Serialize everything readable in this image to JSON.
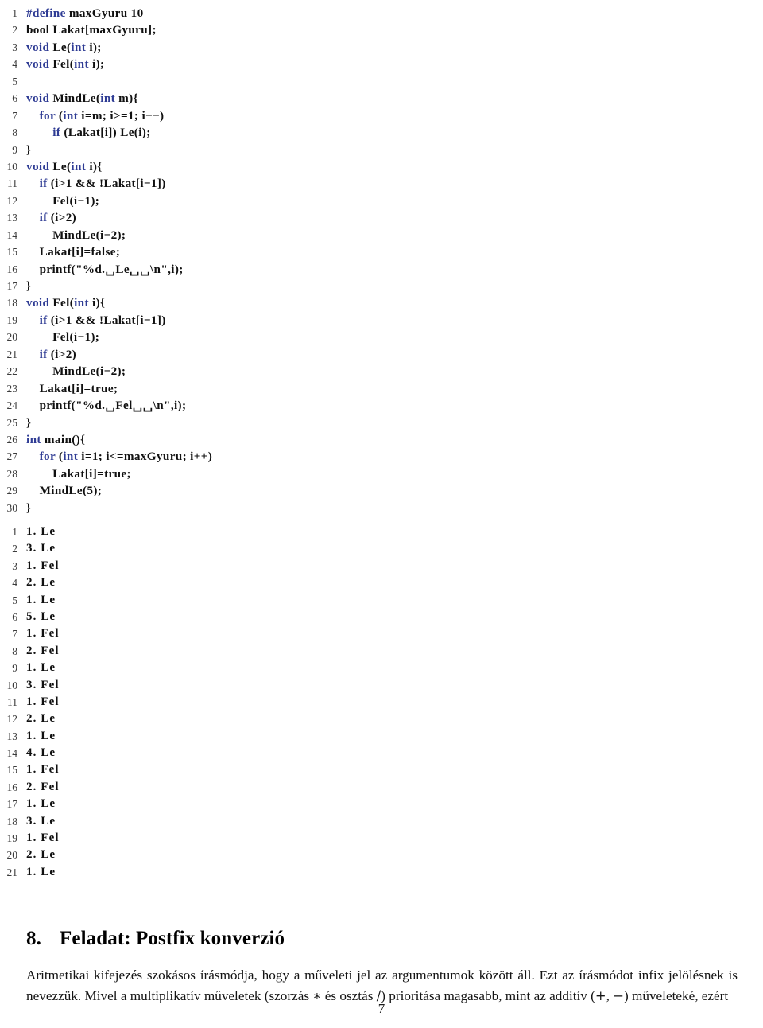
{
  "document": {
    "page_number": "7",
    "language": "hu",
    "keyword_color": "#2e3b94",
    "text_color": "#101010",
    "lineno_color": "#3c3c3c",
    "background_color": "#ffffff"
  },
  "code_listing": {
    "name": "c-source-listing",
    "language": "C",
    "first_line_number": 1,
    "lines": [
      {
        "no": "1",
        "html": "<span class=\"kw\">#define</span> maxGyuru 10"
      },
      {
        "no": "2",
        "html": "bool Lakat[maxGyuru];"
      },
      {
        "no": "3",
        "html": "<span class=\"kw\">void</span> Le(<span class=\"kw\">int</span> i);"
      },
      {
        "no": "4",
        "html": "<span class=\"kw\">void</span> Fel(<span class=\"kw\">int</span> i);"
      },
      {
        "no": "5",
        "html": ""
      },
      {
        "no": "6",
        "html": "<span class=\"kw\">void</span> MindLe(<span class=\"kw\">int</span> m){"
      },
      {
        "no": "7",
        "html": "    <span class=\"kw\">for</span> (<span class=\"kw\">int</span> i=m; i&gt;=1; i−−)"
      },
      {
        "no": "8",
        "html": "        <span class=\"kw\">if</span> (Lakat[i]) Le(i);"
      },
      {
        "no": "9",
        "html": "}"
      },
      {
        "no": "10",
        "html": "<span class=\"kw\">void</span> Le(<span class=\"kw\">int</span> i){"
      },
      {
        "no": "11",
        "html": "    <span class=\"kw\">if</span> (i&gt;1 &amp;&amp; !Lakat[i−1])"
      },
      {
        "no": "12",
        "html": "        Fel(i−1);"
      },
      {
        "no": "13",
        "html": "    <span class=\"kw\">if</span> (i&gt;2)"
      },
      {
        "no": "14",
        "html": "        MindLe(i−2);"
      },
      {
        "no": "15",
        "html": "    Lakat[i]=false;"
      },
      {
        "no": "16",
        "html": "    printf(\"%d.␣Le␣␣\\n\",i);"
      },
      {
        "no": "17",
        "html": "}"
      },
      {
        "no": "18",
        "html": "<span class=\"kw\">void</span> Fel(<span class=\"kw\">int</span> i){"
      },
      {
        "no": "19",
        "html": "    <span class=\"kw\">if</span> (i&gt;1 &amp;&amp; !Lakat[i−1])"
      },
      {
        "no": "20",
        "html": "        Fel(i−1);"
      },
      {
        "no": "21",
        "html": "    <span class=\"kw\">if</span> (i&gt;2)"
      },
      {
        "no": "22",
        "html": "        MindLe(i−2);"
      },
      {
        "no": "23",
        "html": "    Lakat[i]=true;"
      },
      {
        "no": "24",
        "html": "    printf(\"%d.␣Fel␣␣\\n\",i);"
      },
      {
        "no": "25",
        "html": "}"
      },
      {
        "no": "26",
        "html": "<span class=\"kw\">int</span> main(){"
      },
      {
        "no": "27",
        "html": "    <span class=\"kw\">for</span> (<span class=\"kw\">int</span> i=1; i&lt;=maxGyuru; i++)"
      },
      {
        "no": "28",
        "html": "        Lakat[i]=true;"
      },
      {
        "no": "29",
        "html": "    MindLe(5);"
      },
      {
        "no": "30",
        "html": "}"
      }
    ]
  },
  "output_listing": {
    "name": "program-output-listing",
    "first_line_number": 1,
    "lines": [
      {
        "no": "1",
        "html": "1. Le"
      },
      {
        "no": "2",
        "html": "3. Le"
      },
      {
        "no": "3",
        "html": "1. Fel"
      },
      {
        "no": "4",
        "html": "2. Le"
      },
      {
        "no": "5",
        "html": "1. Le"
      },
      {
        "no": "6",
        "html": "5. Le"
      },
      {
        "no": "7",
        "html": "1. Fel"
      },
      {
        "no": "8",
        "html": "2. Fel"
      },
      {
        "no": "9",
        "html": "1. Le"
      },
      {
        "no": "10",
        "html": "3. Fel"
      },
      {
        "no": "11",
        "html": "1. Fel"
      },
      {
        "no": "12",
        "html": "2. Le"
      },
      {
        "no": "13",
        "html": "1. Le"
      },
      {
        "no": "14",
        "html": "4. Le"
      },
      {
        "no": "15",
        "html": "1. Fel"
      },
      {
        "no": "16",
        "html": "2. Fel"
      },
      {
        "no": "17",
        "html": "1. Le"
      },
      {
        "no": "18",
        "html": "3. Le"
      },
      {
        "no": "19",
        "html": "1. Fel"
      },
      {
        "no": "20",
        "html": "2. Le"
      },
      {
        "no": "21",
        "html": "1. Le"
      }
    ]
  },
  "section": {
    "number": "8.",
    "title": "Feladat: Postfix konverzió",
    "full_heading": "8. Feladat: Postfix konverzió"
  },
  "paragraph": {
    "html": "Aritmetikai kifejezés szokásos írásmódja, hogy a műveleti jel az argumentumok között áll. Ezt az írásmódot infix jelölésnek is nevezzük. Mivel a multiplikatív műveletek (szorzás <span class=\"mathop\">∗</span> és osztás <span class=\"mathop\">/</span>) prioritása magasabb, mint az additív (<span class=\"mathop\">+</span>, <span class=\"mathop\">−</span>) műveleteké, ezért",
    "text": "Aritmetikai kifejezés szokásos írásmódja, hogy a műveleti jel az argumentumok között áll. Ezt az írásmódot infix jelölésnek is nevezzük. Mivel a multiplikatív műveletek (szorzás ∗ és osztás /) prioritása magasabb, mint az additív (+, −) műveleteké, ezért"
  }
}
